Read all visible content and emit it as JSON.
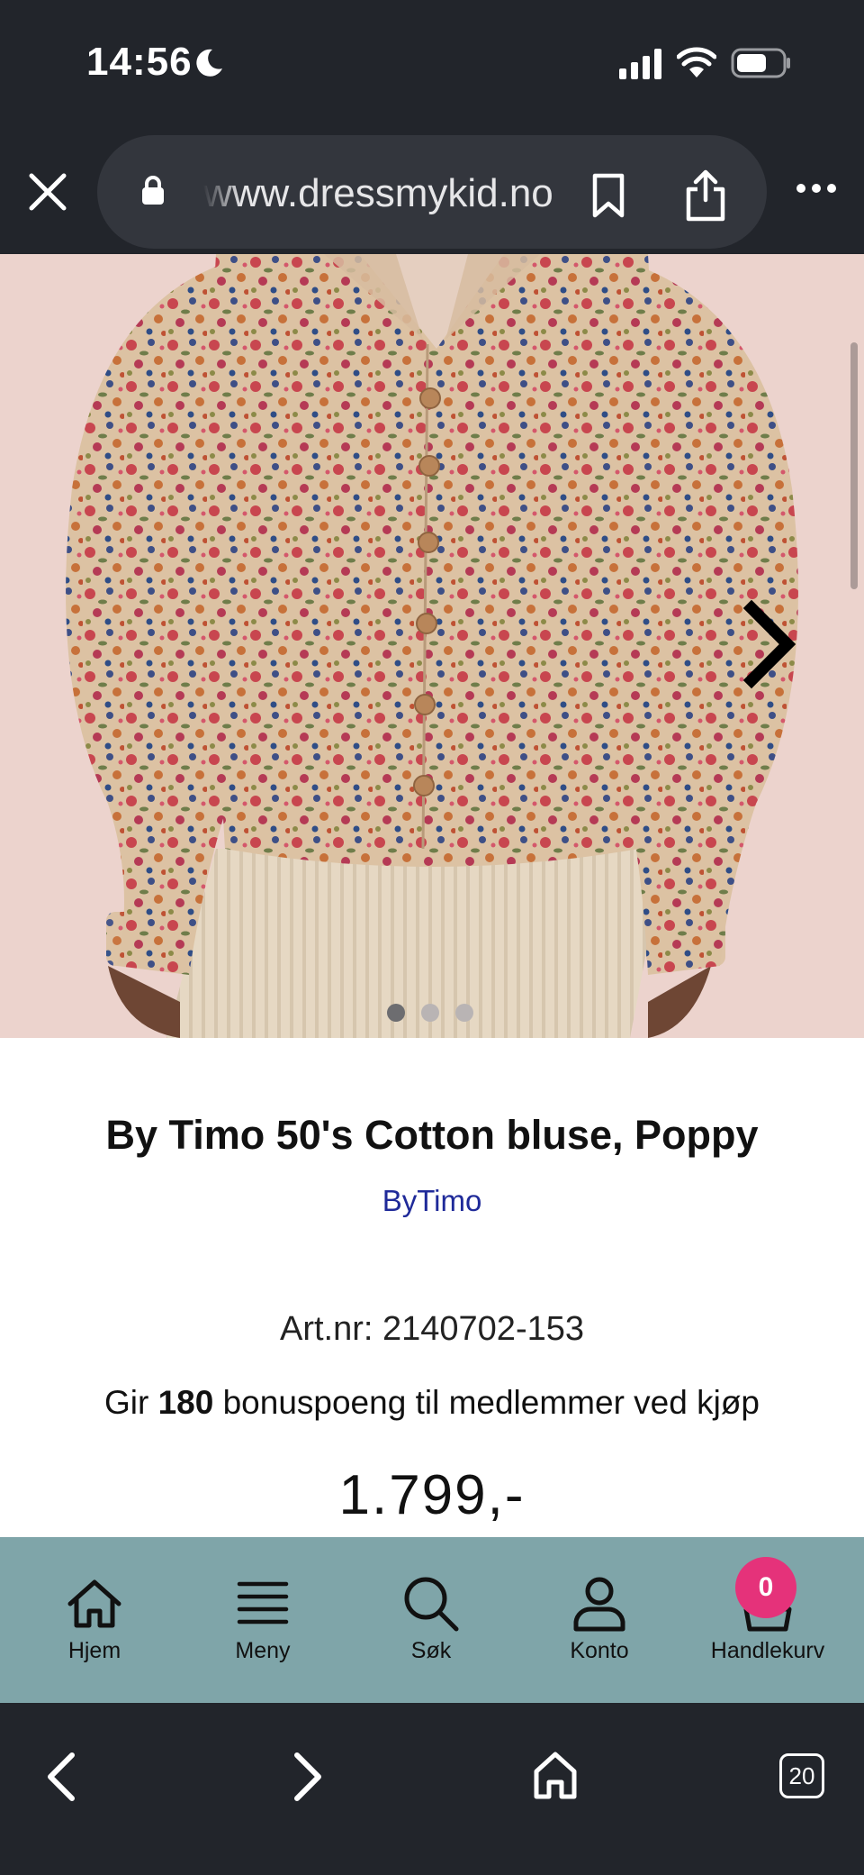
{
  "status_bar": {
    "time": "14:56",
    "icons": [
      "moon-icon",
      "signal-icon",
      "wifi-icon",
      "battery-icon"
    ]
  },
  "browser": {
    "url": "www.dressmykid.no",
    "icons": [
      "close-icon",
      "lock-icon",
      "bookmark-icon",
      "share-icon",
      "more-icon"
    ]
  },
  "gallery": {
    "image_description_icon": "next-image-icon",
    "total_images": 3,
    "active_image_index": 1
  },
  "product": {
    "title": "By Timo 50's Cotton bluse, Poppy",
    "brand": "ByTimo",
    "article_number": "Art.nr: 2140702-153",
    "bonus_prefix": "Gir ",
    "bonus_points": "180",
    "bonus_suffix": " bonuspoeng til medlemmer ved kjøp",
    "price": "1.799,-"
  },
  "site_nav": {
    "items": [
      {
        "label": "Hjem",
        "icon": "home-icon"
      },
      {
        "label": "Meny",
        "icon": "hamburger-icon"
      },
      {
        "label": "Søk",
        "icon": "search-icon"
      },
      {
        "label": "Konto",
        "icon": "account-icon"
      },
      {
        "label": "Handlekurv",
        "icon": "cart-icon"
      }
    ],
    "cart_count": "0"
  },
  "browser_toolbar": {
    "tab_count": "20",
    "icons": [
      "back-icon",
      "forward-icon",
      "home-icon",
      "tabs-icon"
    ]
  },
  "colors": {
    "chrome_background": "#22252b",
    "nav_background": "#7fa5a9",
    "brand_link": "#1f2a99",
    "cart_badge": "#e5327a"
  }
}
